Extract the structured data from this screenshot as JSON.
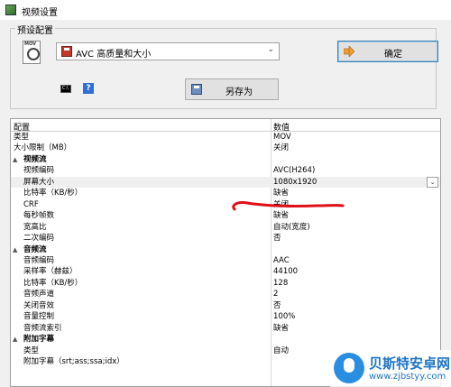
{
  "window": {
    "title": "视频设置"
  },
  "preset": {
    "legend": "预设配置",
    "selected": "AVC 高质量和大小",
    "ok_label": "确定",
    "saveas_label": "另存为",
    "cmd_icon_text": "C:\\"
  },
  "grid": {
    "header_label": "配置",
    "header_value": "数值",
    "rows": [
      {
        "label": "类型",
        "value": "MOV",
        "kind": "top"
      },
      {
        "label": "大小限制（MB）",
        "value": "关闭",
        "kind": "top"
      },
      {
        "label": "视频流",
        "value": "",
        "kind": "category"
      },
      {
        "label": "视频编码",
        "value": "AVC(H264)",
        "kind": "child"
      },
      {
        "label": "屏幕大小",
        "value": "1080x1920",
        "kind": "child",
        "selected": true
      },
      {
        "label": "比特率（KB/秒）",
        "value": "缺省",
        "kind": "child"
      },
      {
        "label": "CRF",
        "value": "关闭",
        "kind": "child"
      },
      {
        "label": "每秒帧数",
        "value": "缺省",
        "kind": "child"
      },
      {
        "label": "宽高比",
        "value": "自动(宽度)",
        "kind": "child"
      },
      {
        "label": "二次编码",
        "value": "否",
        "kind": "child"
      },
      {
        "label": "音频流",
        "value": "",
        "kind": "category"
      },
      {
        "label": "音频编码",
        "value": "AAC",
        "kind": "child"
      },
      {
        "label": "采样率（赫兹）",
        "value": "44100",
        "kind": "child"
      },
      {
        "label": "比特率（KB/秒）",
        "value": "128",
        "kind": "child"
      },
      {
        "label": "音频声道",
        "value": "2",
        "kind": "child"
      },
      {
        "label": "关闭音效",
        "value": "否",
        "kind": "child"
      },
      {
        "label": "音量控制",
        "value": "100%",
        "kind": "child"
      },
      {
        "label": "音频流索引",
        "value": "缺省",
        "kind": "child"
      },
      {
        "label": "附加字幕",
        "value": "",
        "kind": "category"
      },
      {
        "label": "类型",
        "value": "自动",
        "kind": "child"
      },
      {
        "label": "附加字幕（srt;ass;ssa;idx）",
        "value": "",
        "kind": "child"
      }
    ]
  },
  "watermark": {
    "title": "贝斯特安卓网",
    "url": "www.zjbstyy.com"
  },
  "colors": {
    "accent_border": "#3c7fb1",
    "annotation_red": "#e0101a"
  }
}
